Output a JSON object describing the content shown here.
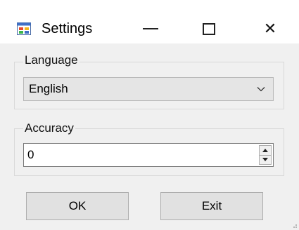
{
  "window": {
    "title": "Settings",
    "app_icon": "form-window-icon",
    "controls": {
      "minimize_icon": "minimize-icon",
      "maximize_icon": "maximize-icon",
      "close_icon": "close-icon",
      "close_glyph": "✕"
    }
  },
  "language_group": {
    "label": "Language",
    "selected": "English",
    "dropdown_icon": "chevron-down-icon"
  },
  "accuracy_group": {
    "label": "Accuracy",
    "value": "0",
    "spin_icons": [
      "spin-up-icon",
      "spin-down-icon"
    ]
  },
  "buttons": {
    "ok": "OK",
    "exit": "Exit"
  },
  "colors": {
    "window_bg": "#f0f0f0",
    "titlebar_bg": "#ffffff",
    "button_bg": "#e1e1e1",
    "combo_bg": "#e5e5e5"
  }
}
